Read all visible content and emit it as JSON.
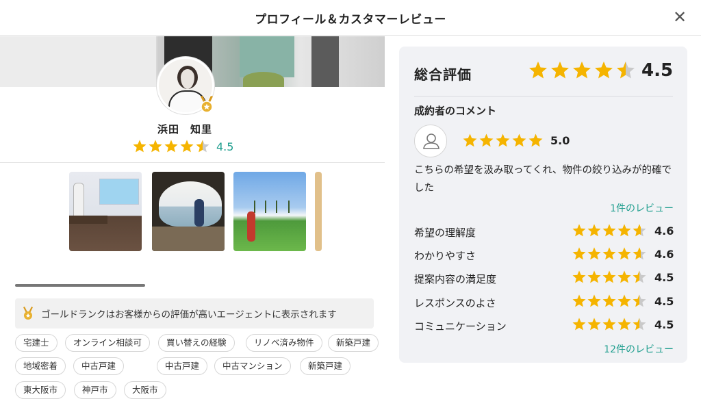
{
  "header": {
    "title": "プロフィール＆カスタマーレビュー",
    "close_icon": "close-icon"
  },
  "profile": {
    "name": "浜田　知里",
    "rating": 4.5,
    "rating_text": "4.5",
    "rank_badge_icon": "gold-medal-icon",
    "gallery": [
      {
        "name": "photo-seminar"
      },
      {
        "name": "photo-cave-beach"
      },
      {
        "name": "photo-golf"
      },
      {
        "name": "photo-partial"
      }
    ],
    "gold_note": "ゴールドランクはお客様からの評価が高いエージェントに表示されます",
    "tags_row1": [
      "宅建士",
      "オンライン相談可",
      "買い替えの経験",
      "リノベ済み物件",
      "新築戸建"
    ],
    "tags_row2": [
      "地域密着",
      "中古戸建",
      "中古戸建",
      "中古マンション",
      "新築戸建"
    ],
    "tags_row3": [
      "東大阪市",
      "神戸市",
      "大阪市"
    ]
  },
  "review": {
    "overall_label": "総合評価",
    "overall_value": 4.5,
    "overall_text": "4.5",
    "comment_heading": "成約者のコメント",
    "comment_rating": 5.0,
    "comment_rating_text": "5.0",
    "comment_text": "こちらの希望を汲み取ってくれ、物件の絞り込みが的確でした",
    "reviews_link_1": "1件のレビュー",
    "criteria": [
      {
        "label": "希望の理解度",
        "value": 4.6,
        "text": "4.6"
      },
      {
        "label": "わかりやすさ",
        "value": 4.6,
        "text": "4.6"
      },
      {
        "label": "提案内容の満足度",
        "value": 4.5,
        "text": "4.5"
      },
      {
        "label": "レスポンスのよさ",
        "value": 4.5,
        "text": "4.5"
      },
      {
        "label": "コミュニケーション",
        "value": 4.5,
        "text": "4.5"
      }
    ],
    "reviews_link_2": "12件のレビュー"
  },
  "colors": {
    "star": "#f5b400",
    "star_empty": "#c9c9c9",
    "accent": "#1f9e8e"
  }
}
